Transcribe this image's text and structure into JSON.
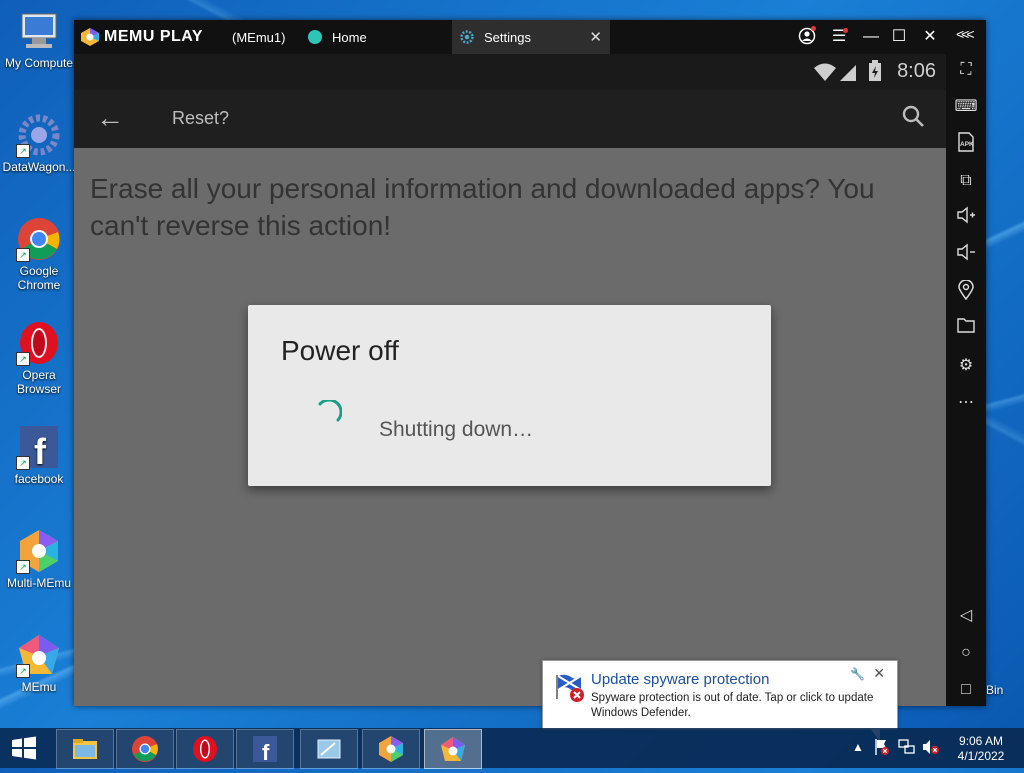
{
  "desktop": {
    "icons": [
      {
        "label": "My Compute"
      },
      {
        "label": "DataWagon..."
      },
      {
        "label": "Google Chrome"
      },
      {
        "label": "Opera Browser"
      },
      {
        "label": "facebook"
      },
      {
        "label": "Multi-MEmu"
      },
      {
        "label": "MEmu"
      }
    ],
    "recycle_label": "Bin"
  },
  "emulator": {
    "brand": "MEMU PLAY",
    "instance": "(MEmu1)",
    "tabs": [
      {
        "label": "Home"
      },
      {
        "label": "Settings",
        "close": "✕"
      }
    ],
    "sidebar_collapse": "<<<"
  },
  "android": {
    "clock": "8:06",
    "appbar_title": "Reset?",
    "erase_text": "Erase all your personal information and downloaded apps? You can't reverse this action!",
    "dialog": {
      "title": "Power off",
      "message": "Shutting down…"
    },
    "accent": "#1a9e8a"
  },
  "notification": {
    "title": "Update spyware protection",
    "body": "Spyware protection is out of date. Tap or click to update Windows Defender."
  },
  "taskbar": {
    "time": "9:06 AM",
    "date": "4/1/2022"
  }
}
